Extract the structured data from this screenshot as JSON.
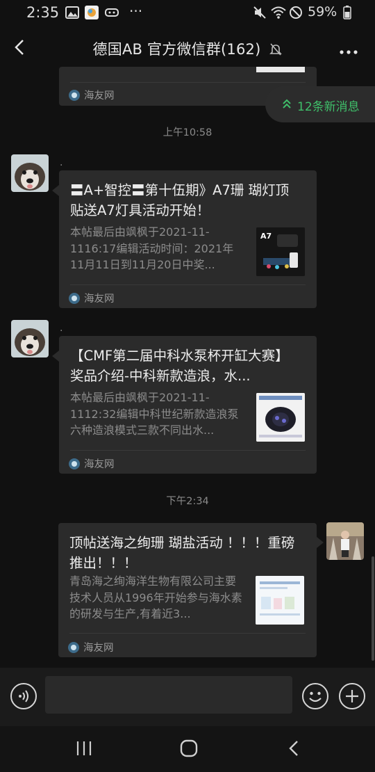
{
  "status_bar": {
    "time": "2:35",
    "dots": "···",
    "battery": "59%"
  },
  "header": {
    "title": "德国AB  官方微信群(162)"
  },
  "new_messages": {
    "label": "12条新消息"
  },
  "top_partial_card": {
    "source": "海友网"
  },
  "messages": [
    {
      "timestamp": "上午10:58",
      "sender": ".",
      "title": "〓A+智控〓第十伍期》A7珊 瑚灯顶贴送A7灯具活动开始！",
      "desc": "本帖最后由飒枫于2021-11-1116:17编辑活动时间：2021年11月11日到11月20日中奖...",
      "thumb_label": "A7",
      "source": "海友网"
    },
    {
      "sender": ".",
      "title": "【CMF第二届中科水泵杯开缸大赛】奖品介绍-中科新款造浪，水...",
      "desc": "本帖最后由飒枫于2021-11-1112:32编辑中科世纪新款造浪泵六种造浪模式三款不同出水...",
      "source": "海友网"
    },
    {
      "timestamp": "下午2:34",
      "title": "顶帖送海之绚珊 瑚盐活动 ！！！重磅推出！！！",
      "desc": "青岛海之绚海洋生物有限公司主要技术人员从1996年开始参与海水素的研发与生产,有着近3...",
      "source": "海友网"
    }
  ],
  "colors": {
    "accent_green": "#3fbf6a",
    "card_bg": "#2b2b2b",
    "page_bg": "#111111"
  }
}
